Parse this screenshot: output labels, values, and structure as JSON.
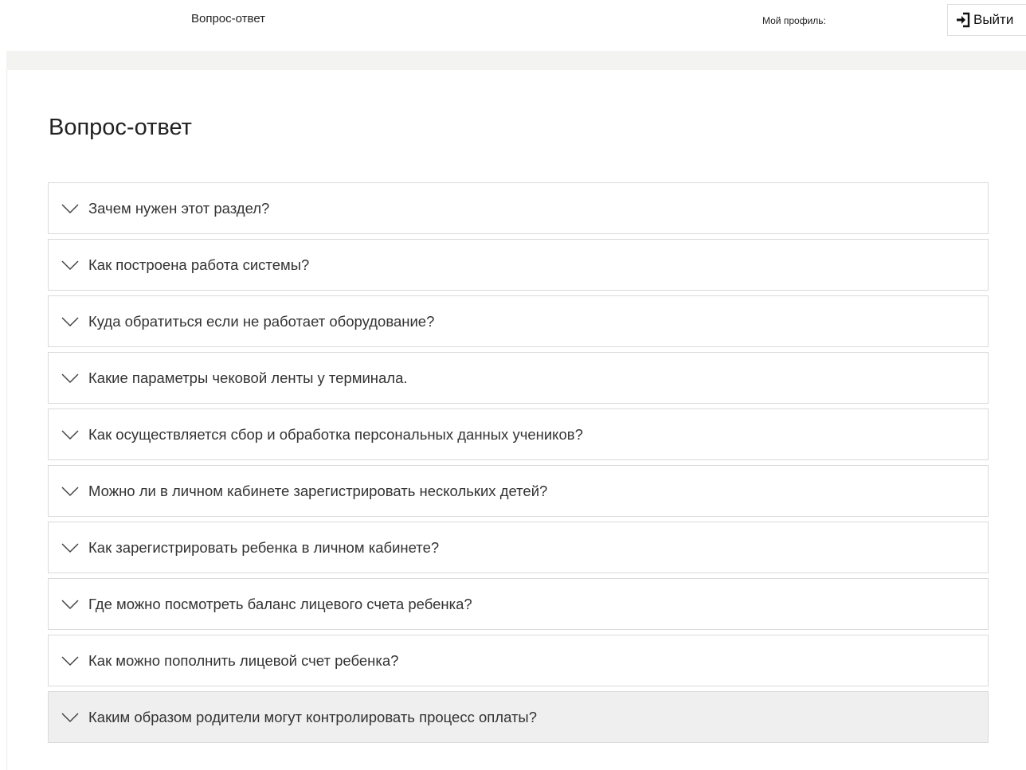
{
  "header": {
    "nav_link": "Вопрос-ответ",
    "profile_label": "Мой профиль:",
    "logout_label": "Выйти",
    "logout_icon": "sign-in-icon"
  },
  "main": {
    "title": "Вопрос-ответ",
    "faq": [
      {
        "question": "Зачем нужен этот раздел?"
      },
      {
        "question": "Как построена работа системы?"
      },
      {
        "question": "Куда обратиться если не работает оборудование?"
      },
      {
        "question": "Какие параметры чековой ленты у терминала."
      },
      {
        "question": "Как осуществляется сбор и обработка персональных данных учеников?"
      },
      {
        "question": "Можно ли в личном кабинете зарегистрировать нескольких детей?"
      },
      {
        "question": "Как зарегистрировать ребенка в личном кабинете?"
      },
      {
        "question": "Где можно посмотреть баланс лицевого счета ребенка?"
      },
      {
        "question": "Как можно пополнить лицевой счет ребенка?"
      },
      {
        "question": "Каким образом родители могут контролировать процесс оплаты?"
      }
    ],
    "expand_icon": "chevron-down-icon",
    "colors": {
      "border": "#dadada",
      "hover_row": "#efefef",
      "band": "#f3f3f1"
    }
  }
}
